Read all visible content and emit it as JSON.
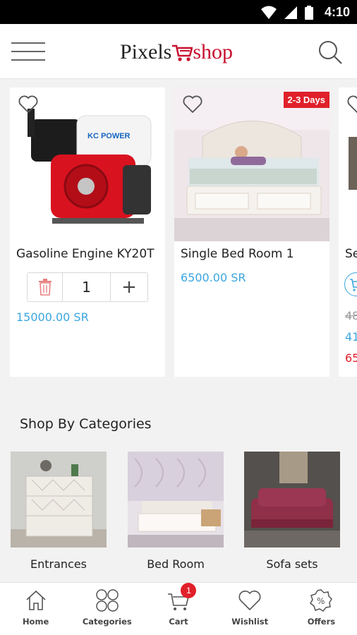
{
  "status_bar": {
    "time": "4:10"
  },
  "header": {
    "logo_part1": "Pixels",
    "logo_part2": "shop"
  },
  "products": [
    {
      "name": "Gasoline Engine KY20T",
      "price": "15000.00 SR",
      "quantity": "1",
      "engine_brand": "KC POWER"
    },
    {
      "name": "Single Bed Room 1",
      "price": "6500.00 SR",
      "badge": "2-3 Days"
    },
    {
      "name": "Se",
      "old_price": "48",
      "price": "41",
      "sale_price": "65"
    }
  ],
  "categories_section": {
    "title": "Shop By Categories",
    "items": [
      {
        "label": "Entrances"
      },
      {
        "label": "Bed Room"
      },
      {
        "label": "Sofa sets"
      }
    ]
  },
  "bottom_nav": {
    "items": [
      {
        "label": "Home",
        "icon": "home-icon"
      },
      {
        "label": "Categories",
        "icon": "categories-icon"
      },
      {
        "label": "Cart",
        "icon": "cart-icon",
        "badge": "1"
      },
      {
        "label": "Wishlist",
        "icon": "heart-icon"
      },
      {
        "label": "Offers",
        "icon": "offers-icon"
      }
    ]
  },
  "colors": {
    "brand_red": "#c8102e",
    "price_blue": "#3aa6e0",
    "badge_red": "#e0202a"
  }
}
